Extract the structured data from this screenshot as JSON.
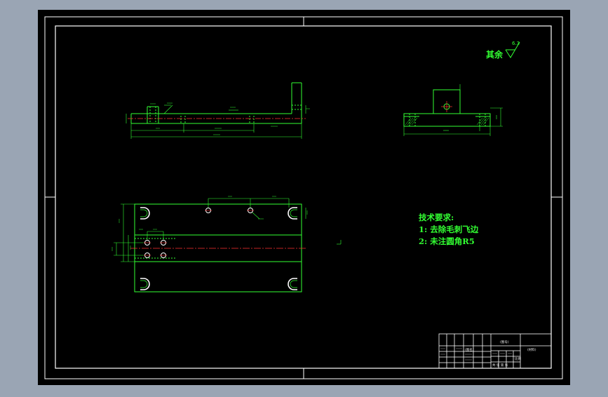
{
  "drawing": {
    "background": "#9aa5b4",
    "sheet_color": "#000000",
    "outline_color": "#ffffff",
    "part_color": "#32ff32",
    "centerline_color": "#ff3030",
    "dimension_color": "#32ff32"
  },
  "roughness": {
    "label": "其余",
    "value": "6.3"
  },
  "tech_requirements": {
    "title": "技术要求:",
    "items": [
      "1: 去除毛刺飞边",
      "2: 未注圆角R5"
    ]
  },
  "title_block": {
    "part_name": "(图名)",
    "drawing_no": "(图号)",
    "material": "(材料)",
    "scale": "比例",
    "sheet": "共  张  第  张"
  }
}
